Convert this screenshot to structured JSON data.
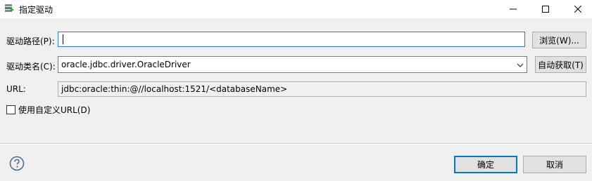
{
  "window": {
    "title": "指定驱动",
    "icon": "driver-app-icon"
  },
  "form": {
    "driver_path_label": "驱动路径(P):",
    "driver_path_value": "",
    "browse_label": "浏览(W)...",
    "driver_class_label": "驱动类名(C):",
    "driver_class_value": "oracle.jdbc.driver.OracleDriver",
    "auto_fetch_label": "自动获取(T)",
    "url_label": "URL:",
    "url_value": "jdbc:oracle:thin:@//localhost:1521/<databaseName>",
    "custom_url_label": "使用自定义URL(D)",
    "custom_url_checked": false
  },
  "footer": {
    "ok_label": "确定",
    "cancel_label": "取消",
    "help_icon": "help-icon"
  },
  "colors": {
    "focus_border": "#2d7bd4",
    "default_button_border": "#0078d7",
    "background": "#f0f0f0"
  }
}
